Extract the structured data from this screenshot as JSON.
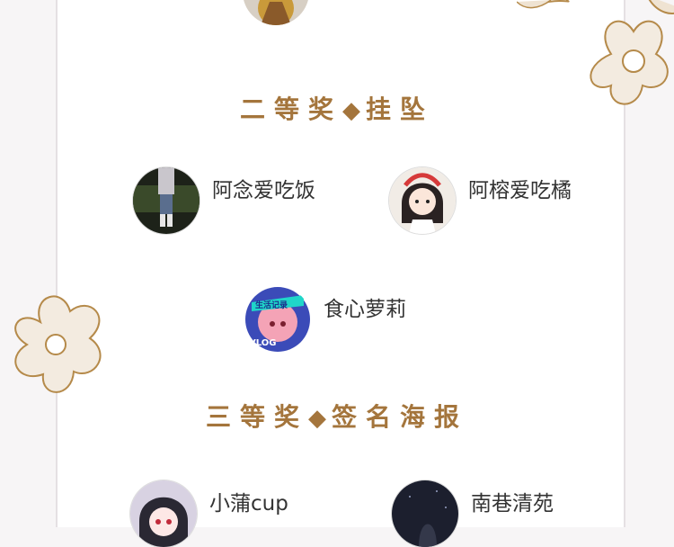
{
  "sections": [
    {
      "title_part1": "二等奖",
      "separator": "◆",
      "title_part2": "挂坠",
      "winners": [
        {
          "name": "阿念爱吃饭",
          "avatar": "photo-avatar-dark"
        },
        {
          "name": "阿榕爱吃橘",
          "avatar": "cartoon-girl-avatar"
        },
        {
          "name": "食心萝莉",
          "avatar": "vlog-anime-avatar"
        }
      ]
    },
    {
      "title_part1": "三等奖",
      "separator": "◆",
      "title_part2": "签名海报",
      "winners": [
        {
          "name": "小蒲cup",
          "avatar": "anime-boy-avatar"
        },
        {
          "name": "南巷清苑",
          "avatar": "dark-photo-avatar"
        }
      ]
    }
  ],
  "avatar_badge_text": "生活记录",
  "avatar_badge_sub": "VLOG",
  "colors": {
    "title": "#a4753c",
    "name": "#333333",
    "border": "#e5e0e3"
  }
}
